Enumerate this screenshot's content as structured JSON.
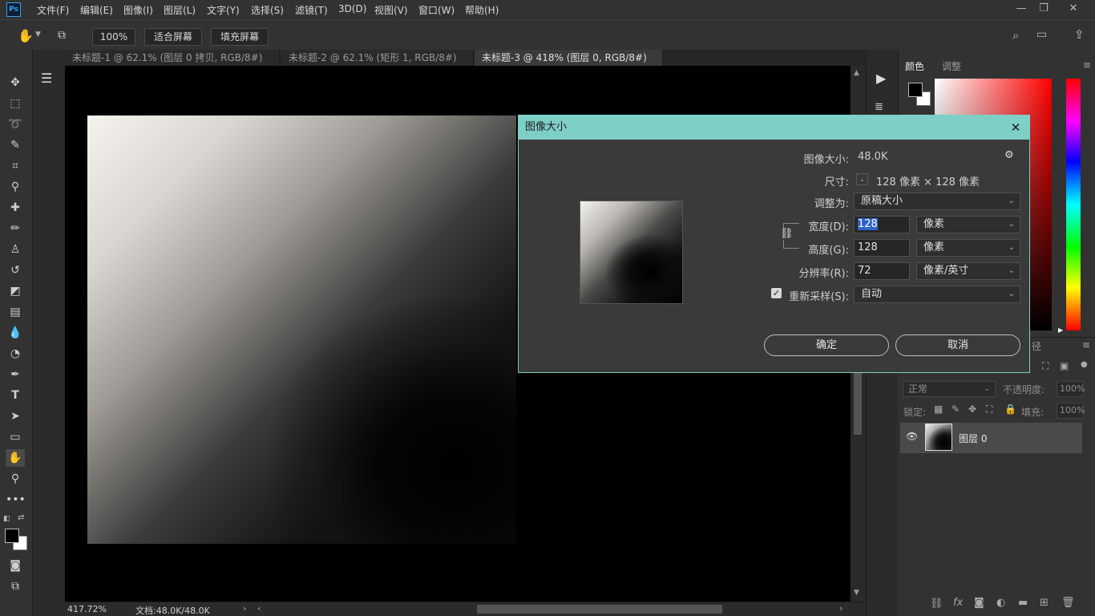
{
  "app": {
    "logo": "Ps"
  },
  "menu": [
    "文件(F)",
    "编辑(E)",
    "图像(I)",
    "图层(L)",
    "文字(Y)",
    "选择(S)",
    "滤镜(T)",
    "3D(D)",
    "视图(V)",
    "窗口(W)",
    "帮助(H)"
  ],
  "options": {
    "zoom": "100%",
    "fit_screen": "适合屏幕",
    "fill_screen": "填充屏幕"
  },
  "tabs": [
    {
      "label": "未标题-1 @ 62.1% (图层 0 拷贝, RGB/8#) *"
    },
    {
      "label": "未标题-2 @ 62.1% (矩形 1, RGB/8#) *"
    },
    {
      "label": "未标题-3 @ 418% (图层 0, RGB/8#) *"
    }
  ],
  "status": {
    "zoom": "417.72%",
    "doc": "文档:48.0K/48.0K"
  },
  "panels": {
    "color_tab": "颜色",
    "adjust_tab": "调整",
    "paths_tab": "径"
  },
  "layers": {
    "blend_mode": "正常",
    "opacity_label": "不透明度:",
    "opacity_value": "100%",
    "lock_label": "锁定:",
    "fill_label": "填充:",
    "fill_value": "100%",
    "layer_name": "图层 0"
  },
  "dialog": {
    "title": "图像大小",
    "image_size_label": "图像大小:",
    "image_size_value": "48.0K",
    "dimensions_label": "尺寸:",
    "dimensions_value": "128 像素 × 128 像素",
    "fit_to_label": "调整为:",
    "fit_to_value": "原稿大小",
    "width_label": "宽度(D):",
    "width_value": "128",
    "width_unit": "像素",
    "height_label": "高度(G):",
    "height_value": "128",
    "height_unit": "像素",
    "resolution_label": "分辨率(R):",
    "resolution_value": "72",
    "resolution_unit": "像素/英寸",
    "resample_label": "重新采样(S):",
    "resample_value": "自动",
    "resample_checked": true,
    "ok": "确定",
    "cancel": "取消"
  },
  "colors": {
    "dialog_accent": "#7ecfc6",
    "selection": "#2e64c8"
  }
}
